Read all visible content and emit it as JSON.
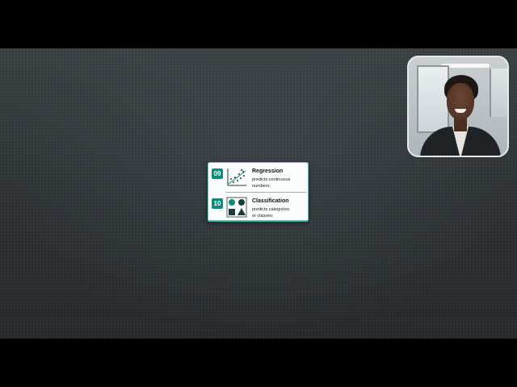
{
  "colors": {
    "accent_teal": "#0f8a7e",
    "card_border": "#4fd1c5",
    "background": "#2f3437"
  },
  "webcam": {
    "icon": "presenter-webcam"
  },
  "card": {
    "items": [
      {
        "number": "09",
        "icon": "scatter-trend-chart-icon",
        "title": "Regression",
        "desc_line1": "predicts continuous",
        "desc_line2": "numbers;"
      },
      {
        "number": "10",
        "icon": "shapes-grid-icon",
        "title": "Classification",
        "desc_line1": "predicts categories",
        "desc_line2": "or classes;"
      }
    ]
  }
}
